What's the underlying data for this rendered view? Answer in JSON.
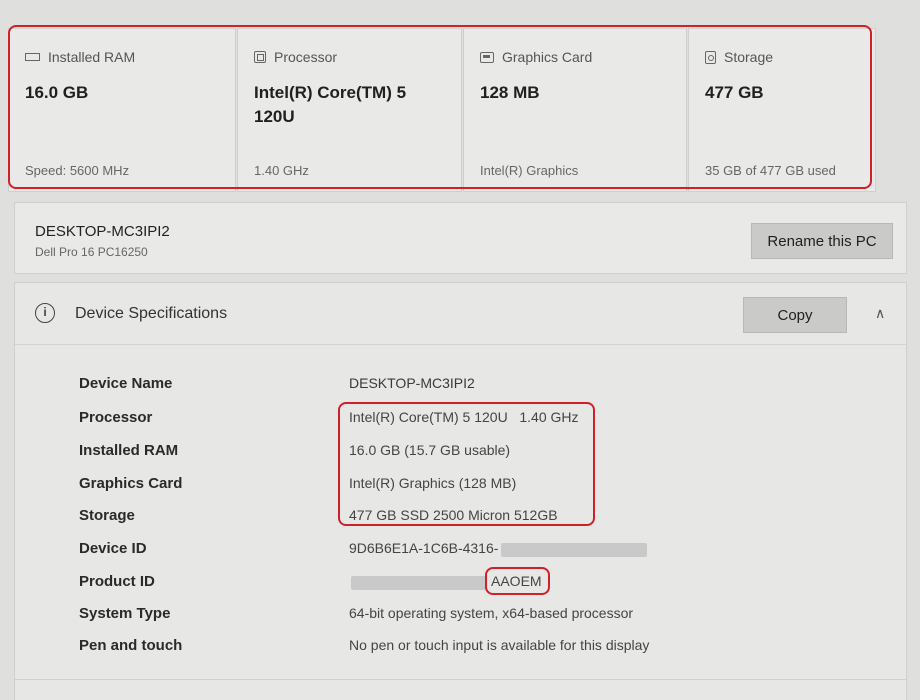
{
  "cards": [
    {
      "title": "Installed RAM",
      "icon": "ram-icon",
      "value": "16.0 GB",
      "sub": "Speed: 5600 MHz"
    },
    {
      "title": "Processor",
      "icon": "processor-icon",
      "value": "Intel(R) Core(TM) 5 120U",
      "sub": "1.40 GHz"
    },
    {
      "title": "Graphics Card",
      "icon": "graphics-card-icon",
      "value": "128 MB",
      "sub": "Intel(R) Graphics"
    },
    {
      "title": "Storage",
      "icon": "storage-icon",
      "value": "477 GB",
      "sub": "35 GB of 477 GB used"
    }
  ],
  "pc": {
    "name": "DESKTOP-MC3IPI2",
    "model": "Dell Pro 16 PC16250",
    "rename_label": "Rename this PC"
  },
  "specs": {
    "title": "Device Specifications",
    "copy_label": "Copy",
    "rows": [
      {
        "label": "Device Name",
        "value": "DESKTOP-MC3IPI2"
      },
      {
        "label": "Processor",
        "value": "Intel(R) Core(TM) 5 120U   1.40 GHz"
      },
      {
        "label": "Installed RAM",
        "value": "16.0 GB (15.7 GB usable)"
      },
      {
        "label": "Graphics Card",
        "value": "Intel(R) Graphics (128 MB)"
      },
      {
        "label": "Storage",
        "value": "477 GB SSD 2500 Micron 512GB"
      },
      {
        "label": "Device ID",
        "value": "9D6B6E1A-1C6B-4316-"
      },
      {
        "label": "Product ID",
        "value": "AAOEM"
      },
      {
        "label": "System Type",
        "value": "64-bit operating system, x64-based processor"
      },
      {
        "label": "Pen and touch",
        "value": "No pen or touch input is available for this display"
      }
    ]
  },
  "colors": {
    "highlight": "#d0202a",
    "background": "#dfdfdd",
    "card": "#e9e9e7",
    "button": "#cacac8"
  }
}
